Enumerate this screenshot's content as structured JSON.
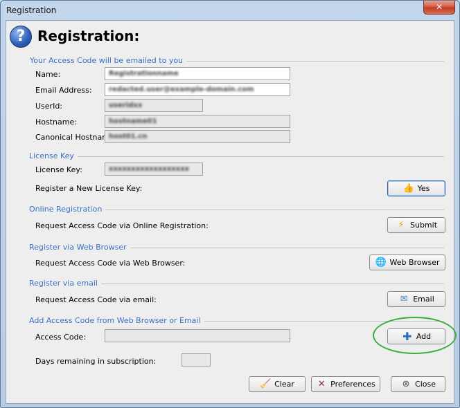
{
  "window": {
    "title": "Registration",
    "close_glyph": "✕"
  },
  "header": {
    "icon": "help-icon",
    "title": "Registration:"
  },
  "sections": {
    "access": {
      "title": "Your Access Code will be emailed to you"
    },
    "license": {
      "title": "License Key"
    },
    "online": {
      "title": "Online Registration"
    },
    "web": {
      "title": "Register via Web Browser"
    },
    "email": {
      "title": "Register via email"
    },
    "add": {
      "title": "Add Access Code from Web Browser or Email"
    }
  },
  "fields": {
    "name": {
      "label": "Name:",
      "value": "Registrationname"
    },
    "email": {
      "label": "Email Address:",
      "value": "redacted.user@example-domain.com"
    },
    "userid": {
      "label": "UserId:",
      "value": "useridxx"
    },
    "hostname": {
      "label": "Hostname:",
      "value": "hostname01"
    },
    "canonical": {
      "label": "Canonical Hostname:",
      "value": "host01.cn"
    },
    "license_key": {
      "label": "License Key:",
      "value": "xxxxxxxxxxxxxxxxxx"
    },
    "access_code": {
      "label": "Access Code:",
      "value": ""
    },
    "days": {
      "label": "Days remaining in subscription:",
      "value": ""
    }
  },
  "rows": {
    "new_license": "Register a New License Key:",
    "online": "Request Access Code via Online Registration:",
    "web": "Request Access Code via Web Browser:",
    "email": "Request Access Code via email:"
  },
  "buttons": {
    "yes": {
      "label": "Yes",
      "icon": "thumbs-up-icon"
    },
    "submit": {
      "label": "Submit",
      "icon": "lightning-icon"
    },
    "web_browser": {
      "label": "Web Browser",
      "icon": "globe-icon"
    },
    "email": {
      "label": "Email",
      "icon": "envelope-icon"
    },
    "add": {
      "label": "Add",
      "icon": "plus-icon"
    },
    "clear": {
      "label": "Clear",
      "icon": "broom-icon"
    },
    "preferences": {
      "label": "Preferences",
      "icon": "tools-icon"
    },
    "close": {
      "label": "Close",
      "icon": "close-circle-icon"
    }
  },
  "colors": {
    "section_title": "#3a6fc4",
    "highlight_ellipse": "#3cad3c",
    "close_button": "#c9462d"
  }
}
